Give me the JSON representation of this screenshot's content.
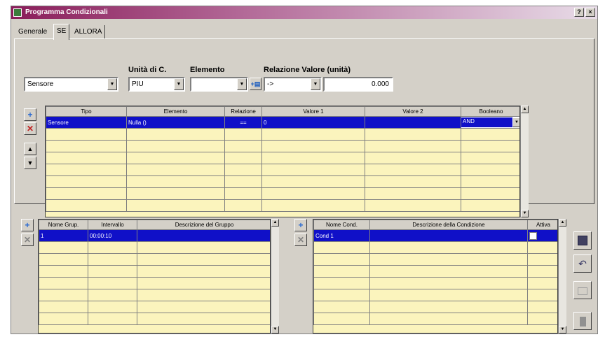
{
  "window": {
    "title": "Programma Condizionali",
    "help_btn": "?",
    "close_btn": "×"
  },
  "tabs": [
    {
      "label": "Generale"
    },
    {
      "label": "SE"
    },
    {
      "label": "ALLORA"
    }
  ],
  "condition_builder": {
    "sensor_combo": "Sensore",
    "unit_label": "Unità di C.",
    "unit_combo": "PIU",
    "element_label": "Elemento",
    "element_combo": "",
    "relation_label": "Relazione Valore (unità)",
    "relation_combo": "->",
    "value_field": "0.000"
  },
  "main_grid": {
    "columns": [
      "Tipo",
      "Elemento",
      "Relazione",
      "Valore 1",
      "Valore 2",
      "Booleano"
    ],
    "rows": [
      [
        "Sensore",
        "Nulla ()",
        "==",
        "0",
        "",
        "AND"
      ]
    ],
    "empty_rows": 7
  },
  "groups_grid": {
    "columns": [
      "Nome Grup.",
      "Intervallo",
      "Descrizione del Gruppo"
    ],
    "rows": [
      [
        "1",
        "00:00:10",
        ""
      ]
    ],
    "empty_rows": 6
  },
  "conditions_grid": {
    "columns": [
      "Nome Cond.",
      "Descrizione della Condizione",
      "Attiva"
    ],
    "rows": [
      [
        "Cond 1",
        "",
        ""
      ]
    ],
    "empty_rows": 6
  },
  "side_buttons": {
    "add": "+",
    "delete": "✕",
    "move_up": "▲",
    "move_down": "▼",
    "save": "💾",
    "undo": "↶"
  },
  "colors": {
    "selection": "#1010c8",
    "grid_bg": "#fbf4bd",
    "dialog_bg": "#d4d0c8"
  }
}
